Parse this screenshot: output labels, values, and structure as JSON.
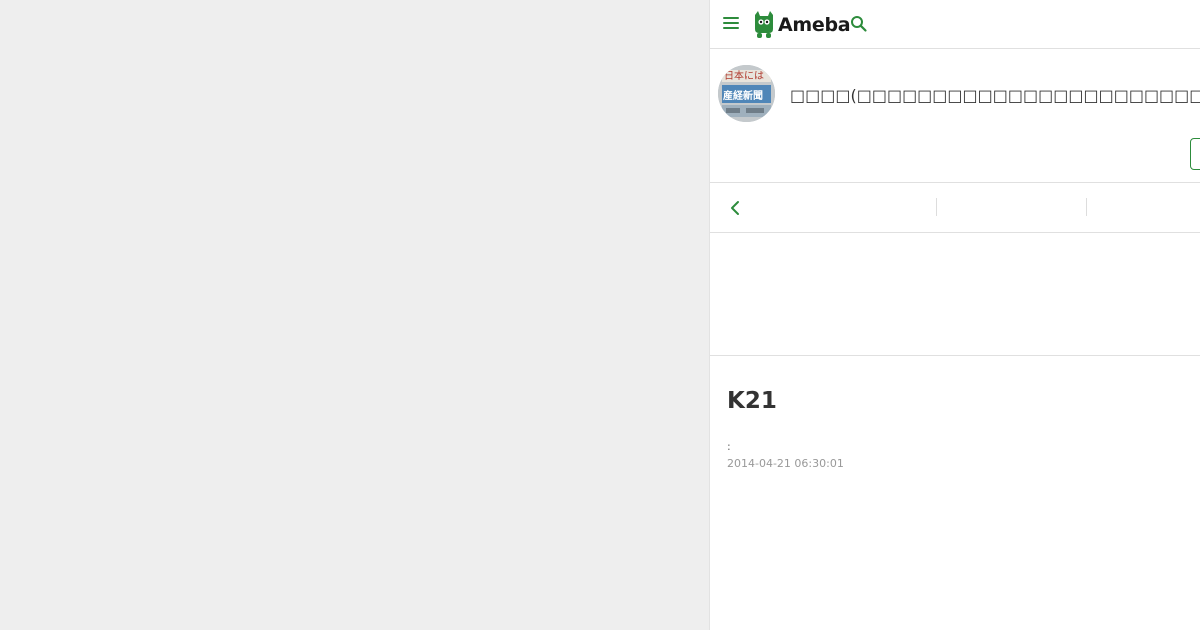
{
  "header": {
    "logo_text": "Ameba",
    "menu_icon": "hamburger-menu-icon",
    "search_icon": "search-icon",
    "accent_color": "#2d8c3c"
  },
  "blog": {
    "title": "□□□□(□□□□□□□□□□□□□□□□□□□□□□□□□□□□□□□□□",
    "avatar_lines": [
      "日本には",
      "産経新聞"
    ]
  },
  "nav": {
    "back_icon": "chevron-left-icon"
  },
  "article": {
    "title": "K21",
    "meta_label": ":",
    "date": "2014-04-21 06:30:01"
  }
}
